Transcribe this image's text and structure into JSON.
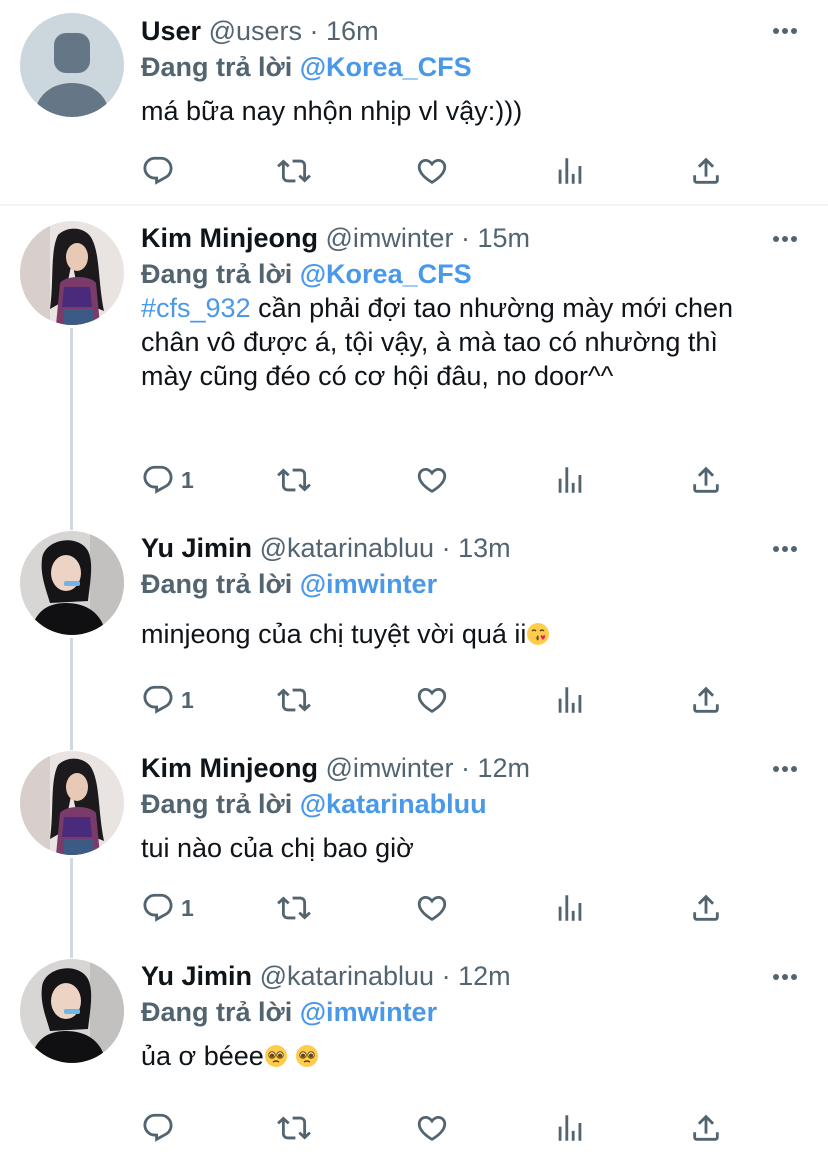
{
  "tweets": [
    {
      "name": "User",
      "handle": "@users",
      "time": "16m",
      "reply_prefix": "Đang trả lời",
      "reply_to": "@Korea_CFS",
      "text": "má bữa nay nhộn nhịp vl vậy:)))",
      "reply_count": ""
    },
    {
      "name": "Kim Minjeong",
      "handle": "@imwinter",
      "time": "15m",
      "reply_prefix": "Đang trả lời",
      "reply_to": "@Korea_CFS",
      "hashtag": "#cfs_932",
      "text": " cần phải đợi tao nhường mày mới chen chân vô được á, tội vậy, à mà tao có nhường thì mày cũng đéo có cơ hội đâu, no door^^",
      "reply_count": "1"
    },
    {
      "name": "Yu Jimin",
      "handle": "@katarinabluu",
      "time": "13m",
      "reply_prefix": "Đang trả lời",
      "reply_to": "@imwinter",
      "text": "minjeong của chị tuyệt vời quá ii",
      "emoji": "kissing-face-emoji",
      "reply_count": "1"
    },
    {
      "name": "Kim Minjeong",
      "handle": "@imwinter",
      "time": "12m",
      "reply_prefix": "Đang trả lời",
      "reply_to": "@katarinabluu",
      "text": "tui nào của chị bao giờ",
      "reply_count": "1"
    },
    {
      "name": "Yu Jimin",
      "handle": "@katarinabluu",
      "time": "12m",
      "reply_prefix": "Đang trả lời",
      "reply_to": "@imwinter",
      "text": "ủa ơ béee",
      "emoji": "pleading-face-emoji",
      "reply_count": ""
    }
  ],
  "icons": [
    "reply-icon",
    "retweet-icon",
    "like-icon",
    "views-icon",
    "share-icon",
    "more-icon"
  ],
  "colors": {
    "link": "#4a99e9",
    "muted": "#536471",
    "text": "#0f1419",
    "thread": "#cfd9de"
  }
}
